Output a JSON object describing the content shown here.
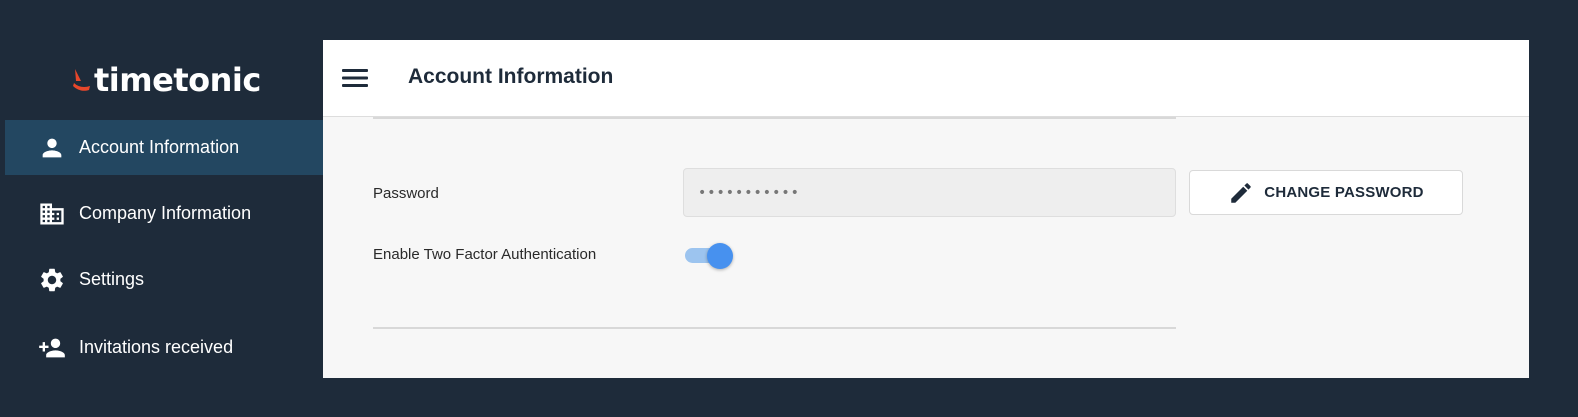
{
  "brand": {
    "name": "timetonic",
    "accent_color": "#e8472b"
  },
  "sidebar": {
    "items": [
      {
        "label": "Account Information",
        "icon": "person-icon",
        "active": true
      },
      {
        "label": "Company Information",
        "icon": "building-icon",
        "active": false
      },
      {
        "label": "Settings",
        "icon": "gear-icon",
        "active": false
      },
      {
        "label": "Invitations received",
        "icon": "person-add-icon",
        "active": false
      }
    ]
  },
  "header": {
    "title": "Account Information",
    "menu_icon": "hamburger-menu-icon"
  },
  "form": {
    "password_label": "Password",
    "password_value": "•••••••••••",
    "change_password_label": "CHANGE PASSWORD",
    "change_password_icon": "pencil-icon",
    "two_factor_label": "Enable Two Factor Authentication",
    "two_factor_enabled": true
  },
  "colors": {
    "sidebar_bg": "#1e2b3a",
    "active_item_bg": "#234761",
    "toggle_on": "#4791ef"
  }
}
